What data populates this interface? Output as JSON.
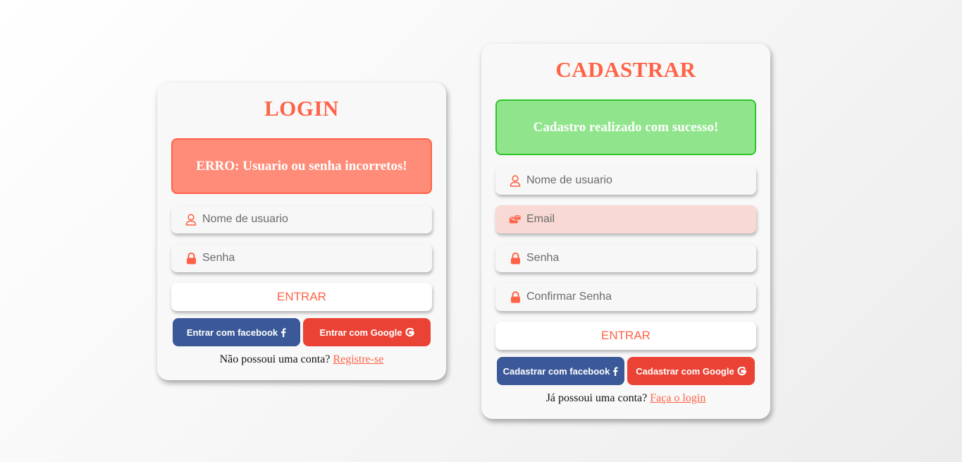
{
  "colors": {
    "accent": "#ff6347",
    "error_bg": "#ff8c78",
    "success_bg": "#90e58c",
    "success_border": "#2fc52a",
    "facebook": "#3b5998",
    "google": "#ea4335",
    "invalid_field_bg": "#f8d9d4"
  },
  "login": {
    "title": "LOGIN",
    "alert": "ERRO: Usuario ou senha incorretos!",
    "username": {
      "placeholder": "Nome de usuario",
      "value": "",
      "icon": "user-icon"
    },
    "password": {
      "placeholder": "Senha",
      "value": "",
      "icon": "lock-icon"
    },
    "submit_label": "ENTRAR",
    "facebook_label": "Entrar com facebook",
    "google_label": "Entrar com Google",
    "footer_text": "Não possoui uma conta?",
    "footer_link": "Registre-se"
  },
  "register": {
    "title": "CADASTRAR",
    "alert": "Cadastro realizado com sucesso!",
    "username": {
      "placeholder": "Nome de usuario",
      "value": "",
      "icon": "user-icon"
    },
    "email": {
      "placeholder": "Email",
      "value": "",
      "icon": "envelope-icon"
    },
    "password": {
      "placeholder": "Senha",
      "value": "",
      "icon": "lock-icon"
    },
    "confirm_password": {
      "placeholder": "Confirmar Senha",
      "value": "",
      "icon": "lock-icon"
    },
    "submit_label": "ENTRAR",
    "facebook_label": "Cadastrar com facebook",
    "google_label": "Cadastrar com Google",
    "footer_text": "Já possoui uma conta?",
    "footer_link": "Faça o login"
  }
}
